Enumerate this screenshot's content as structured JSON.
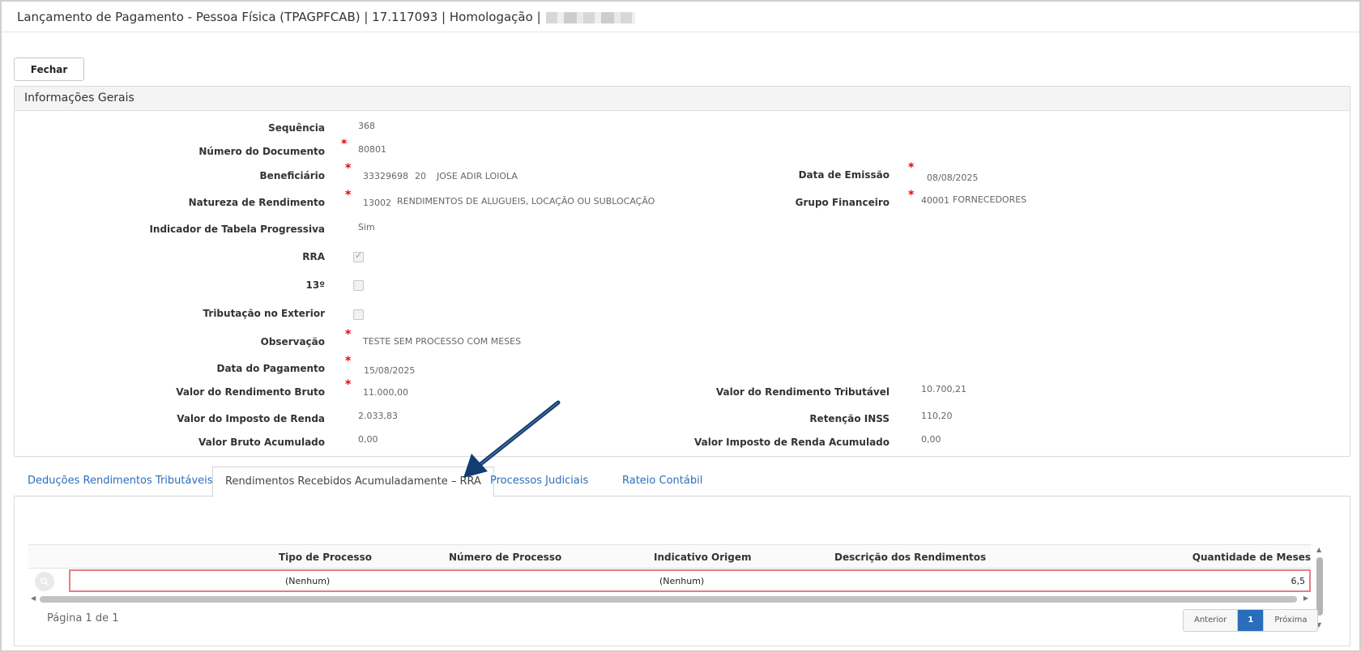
{
  "window": {
    "title": "Lançamento de Pagamento - Pessoa Física (TPAGPFCAB) | 17.117093 | Homologação |"
  },
  "toolbar": {
    "close_label": "Fechar"
  },
  "panel": {
    "title": "Informações Gerais",
    "fields": {
      "sequencia": {
        "label": "Sequência",
        "value": "368"
      },
      "numero_documento": {
        "label": "Número do Documento",
        "value": "80801"
      },
      "beneficiario": {
        "label": "Beneficiário",
        "code": "33329698",
        "sub": "20",
        "name": "JOSE ADIR LOIOLA"
      },
      "data_emissao": {
        "label": "Data de Emissão",
        "value": "08/08/2025"
      },
      "natureza_rendimento": {
        "label": "Natureza de Rendimento",
        "code": "13002",
        "desc": "RENDIMENTOS DE ALUGUEIS, LOCAÇÃO OU SUBLOCAÇÃO"
      },
      "grupo_financeiro": {
        "label": "Grupo Financeiro",
        "code": "40001",
        "desc": "FORNECEDORES"
      },
      "indicador_tabela": {
        "label": "Indicador de Tabela Progressiva",
        "value": "Sim"
      },
      "rra": {
        "label": "RRA",
        "checked": true
      },
      "decimo_terceiro": {
        "label": "13º",
        "checked": false
      },
      "tributacao_exterior": {
        "label": "Tributação no Exterior",
        "checked": false
      },
      "observacao": {
        "label": "Observação",
        "value": "TESTE SEM PROCESSO COM MESES"
      },
      "data_pagamento": {
        "label": "Data do Pagamento",
        "value": "15/08/2025"
      },
      "valor_rendimento_bruto": {
        "label": "Valor do Rendimento Bruto",
        "value": "11.000,00"
      },
      "valor_rendimento_tributavel": {
        "label": "Valor do Rendimento Tributável",
        "value": "10.700,21"
      },
      "valor_imposto_renda": {
        "label": "Valor do Imposto de Renda",
        "value": "2.033,83"
      },
      "retencao_inss": {
        "label": "Retenção INSS",
        "value": "110,20"
      },
      "valor_bruto_acumulado": {
        "label": "Valor Bruto Acumulado",
        "value": "0,00"
      },
      "valor_ir_acumulado": {
        "label": "Valor Imposto de Renda Acumulado",
        "value": "0,00"
      }
    }
  },
  "tabs": [
    {
      "label": "Deduções Rendimentos Tributáveis",
      "active": false
    },
    {
      "label": "Rendimentos Recebidos Acumuladamente – RRA",
      "active": true
    },
    {
      "label": "Processos Judiciais",
      "active": false
    },
    {
      "label": "Rateio Contábil",
      "active": false
    }
  ],
  "grid": {
    "columns": [
      "Tipo de Processo",
      "Número de Processo",
      "Indicativo Origem",
      "Descrição dos Rendimentos",
      "Quantidade de Meses"
    ],
    "rows": [
      {
        "tipo_processo": "(Nenhum)",
        "numero_processo": "",
        "indicativo_origem": "(Nenhum)",
        "descricao": "",
        "quantidade_meses": "6,5"
      }
    ]
  },
  "pagination": {
    "summary": "Página 1 de 1",
    "prev_label": "Anterior",
    "current_page": "1",
    "next_label": "Próxima"
  },
  "colors": {
    "link": "#2a6ebb",
    "required": "#ee0000",
    "highlight_row_border": "#e37f86",
    "arrow": "#123d73"
  }
}
